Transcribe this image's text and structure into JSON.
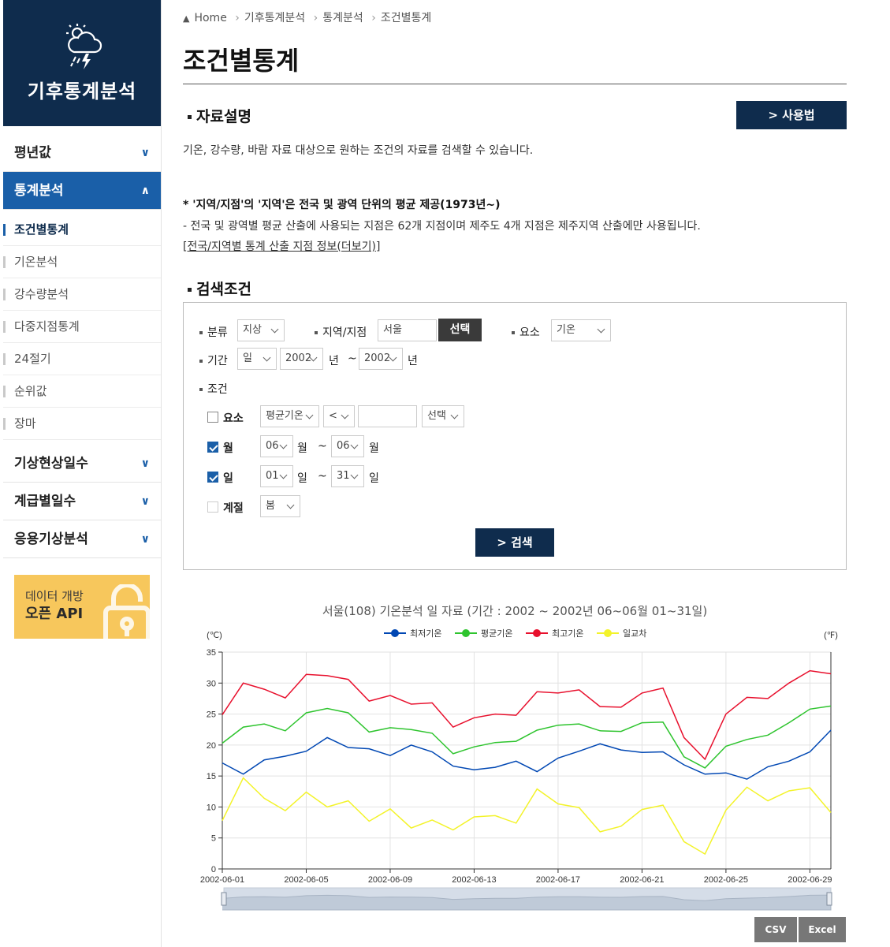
{
  "sidebar": {
    "logo_title": "기후통계분석",
    "menu": [
      {
        "label": "평년값",
        "state": "collapsed"
      },
      {
        "label": "통계분석",
        "state": "expanded"
      },
      {
        "label": "기상현상일수",
        "state": "collapsed"
      },
      {
        "label": "계급별일수",
        "state": "collapsed"
      },
      {
        "label": "응용기상분석",
        "state": "collapsed"
      }
    ],
    "submenu": [
      "조건별통계",
      "기온분석",
      "강수량분석",
      "다중지점통계",
      "24절기",
      "순위값",
      "장마"
    ],
    "active_sub": "조건별통계",
    "banner": {
      "line1": "데이터 개방",
      "line2": "오픈 API"
    }
  },
  "breadcrumb": [
    "Home",
    "기후통계분석",
    "통계분석",
    "조건별통계"
  ],
  "page_title": "조건별통계",
  "description": {
    "heading": "자료설명",
    "usage_button": "> 사용법",
    "text": "기온, 강수량, 바람 자료 대상으로 원하는 조건의 자료를 검색할 수 있습니다.",
    "note_bold": "* '지역/지점'의 '지역'은 전국 및 광역 단위의 평균 제공(1973년~)",
    "note_text": "- 전국 및 광역별 평균 산출에 사용되는 지점은 62개 지점이며 제주도 4개 지점은 제주지역 산출에만 사용됩니다.",
    "link": "[전국/지역별 통계 산출 지점 정보(더보기)]"
  },
  "search": {
    "heading": "검색조건",
    "category_label": "분류",
    "category_value": "지상",
    "region_label": "지역/지점",
    "region_value": "서울",
    "region_button": "선택",
    "element_label": "요소",
    "element_value": "기온",
    "period_label": "기간",
    "period_unit": "일",
    "period_from": "2002",
    "period_to": "2002",
    "year_suffix": "년",
    "tilde": "~",
    "condition_label": "조건",
    "cond_element": {
      "label": "요소",
      "checked": false,
      "field": "평균기온",
      "op": "<",
      "value": "",
      "select": "선택"
    },
    "cond_month": {
      "label": "월",
      "checked": true,
      "from": "06",
      "to": "06",
      "unit": "월"
    },
    "cond_day": {
      "label": "일",
      "checked": true,
      "from": "01",
      "to": "31",
      "unit": "일"
    },
    "cond_season": {
      "label": "계절",
      "checked": false,
      "value": "봄"
    },
    "submit": "> 검색"
  },
  "chart_data": {
    "type": "line",
    "title": "서울(108) 기온분석 일 자료 (기간 : 2002 ~ 2002년  06~06월 01~31일)",
    "y_unit_left": "(℃)",
    "y_unit_right": "(℉)",
    "ylim": [
      0,
      35
    ],
    "yticks": [
      "0",
      "5",
      "10",
      "15",
      "20",
      "25",
      "30",
      "35"
    ],
    "x": [
      "2002-06-01",
      "2002-06-02",
      "2002-06-03",
      "2002-06-04",
      "2002-06-05",
      "2002-06-06",
      "2002-06-07",
      "2002-06-08",
      "2002-06-09",
      "2002-06-10",
      "2002-06-11",
      "2002-06-12",
      "2002-06-13",
      "2002-06-14",
      "2002-06-15",
      "2002-06-16",
      "2002-06-17",
      "2002-06-18",
      "2002-06-19",
      "2002-06-20",
      "2002-06-21",
      "2002-06-22",
      "2002-06-23",
      "2002-06-24",
      "2002-06-25",
      "2002-06-26",
      "2002-06-27",
      "2002-06-28",
      "2002-06-29",
      "2002-06-30"
    ],
    "xtick_labels": [
      "2002-06-01",
      "2002-06-05",
      "2002-06-09",
      "2002-06-13",
      "2002-06-17",
      "2002-06-21",
      "2002-06-25",
      "2002-06-29"
    ],
    "legend_position": "top",
    "grid": true,
    "series": [
      {
        "name": "최저기온",
        "color": "#0047b3",
        "values": [
          17.1,
          15.3,
          17.6,
          18.2,
          19.0,
          21.2,
          19.6,
          19.4,
          18.3,
          20.0,
          18.9,
          16.6,
          16.0,
          16.4,
          17.4,
          15.7,
          17.9,
          19.0,
          20.2,
          19.2,
          18.8,
          18.9,
          16.8,
          15.3,
          15.5,
          14.5,
          16.5,
          17.4,
          18.9,
          22.4
        ]
      },
      {
        "name": "평균기온",
        "color": "#2ec42e",
        "values": [
          20.3,
          22.9,
          23.4,
          22.3,
          25.2,
          25.9,
          25.2,
          22.1,
          22.8,
          22.5,
          21.9,
          18.6,
          19.7,
          20.4,
          20.6,
          22.4,
          23.2,
          23.4,
          22.3,
          22.2,
          23.6,
          23.7,
          18.1,
          16.3,
          19.8,
          20.9,
          21.6,
          23.6,
          25.8,
          26.3
        ]
      },
      {
        "name": "최고기온",
        "color": "#e8102d",
        "values": [
          24.9,
          30.0,
          29.0,
          27.6,
          31.4,
          31.2,
          30.6,
          27.1,
          28.0,
          26.6,
          26.8,
          22.9,
          24.4,
          25.0,
          24.8,
          28.6,
          28.4,
          28.9,
          26.2,
          26.1,
          28.4,
          29.2,
          21.2,
          17.7,
          25.0,
          27.7,
          27.5,
          30.0,
          32.0,
          31.5
        ]
      },
      {
        "name": "일교차",
        "color": "#f3f32a",
        "values": [
          7.8,
          14.7,
          11.4,
          9.4,
          12.4,
          10.0,
          11.0,
          7.7,
          9.7,
          6.6,
          7.9,
          6.3,
          8.4,
          8.6,
          7.4,
          12.9,
          10.5,
          9.9,
          6.0,
          6.9,
          9.6,
          10.3,
          4.4,
          2.4,
          9.5,
          13.2,
          11.0,
          12.6,
          13.1,
          9.1
        ]
      }
    ]
  },
  "downloads": {
    "csv": "CSV",
    "excel": "Excel"
  }
}
